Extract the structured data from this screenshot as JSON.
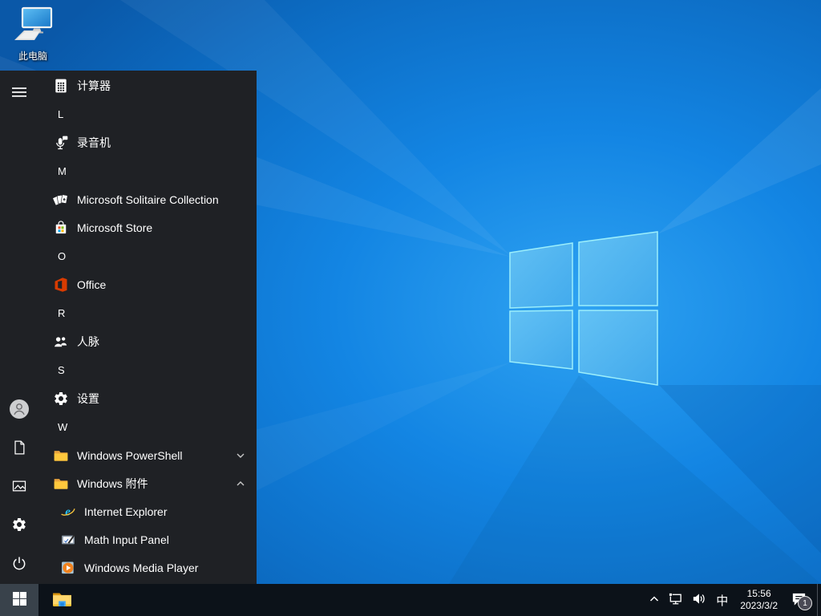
{
  "colors": {
    "wallpaper_blue": "#1385e3",
    "menu_bg": "#1f2125",
    "taskbar_bg": "#0c1219",
    "start_pressed": "#39424b",
    "folder_yellow": "#ffc83d",
    "office_orange": "#d83b01",
    "store_red": "#f25022",
    "store_green": "#7fba00",
    "store_blue": "#00a4ef",
    "store_yellow": "#ffb900",
    "ie_blue": "#26c2f3",
    "wmp_orange": "#f0821e"
  },
  "desktop": {
    "this_pc_label": "此电脑"
  },
  "start_menu": {
    "rail": [
      {
        "name": "menu",
        "icon": "hamburger"
      },
      {
        "name": "user",
        "icon": "user"
      },
      {
        "name": "documents",
        "icon": "document"
      },
      {
        "name": "pictures",
        "icon": "pictures"
      },
      {
        "name": "settings",
        "icon": "gear"
      },
      {
        "name": "power",
        "icon": "power"
      }
    ],
    "apps": [
      {
        "kind": "app",
        "label": "计算器",
        "icon": "calculator"
      },
      {
        "kind": "section",
        "label": "L"
      },
      {
        "kind": "app",
        "label": "录音机",
        "icon": "voice-recorder"
      },
      {
        "kind": "section",
        "label": "M"
      },
      {
        "kind": "app",
        "label": "Microsoft Solitaire Collection",
        "icon": "solitaire"
      },
      {
        "kind": "app",
        "label": "Microsoft Store",
        "icon": "store"
      },
      {
        "kind": "section",
        "label": "O"
      },
      {
        "kind": "app",
        "label": "Office",
        "icon": "office"
      },
      {
        "kind": "section",
        "label": "R"
      },
      {
        "kind": "app",
        "label": "人脉",
        "icon": "people"
      },
      {
        "kind": "section",
        "label": "S"
      },
      {
        "kind": "app",
        "label": "设置",
        "icon": "gear"
      },
      {
        "kind": "section",
        "label": "W"
      },
      {
        "kind": "folder",
        "label": "Windows PowerShell",
        "icon": "folder",
        "chevron": "down"
      },
      {
        "kind": "folder",
        "label": "Windows 附件",
        "icon": "folder",
        "chevron": "up"
      },
      {
        "kind": "subapp",
        "label": "Internet Explorer",
        "icon": "internet-explorer"
      },
      {
        "kind": "subapp",
        "label": "Math Input Panel",
        "icon": "math-input"
      },
      {
        "kind": "subapp",
        "label": "Windows Media Player",
        "icon": "media-player"
      }
    ]
  },
  "taskbar": {
    "start_icon": "windows",
    "pinned": [
      {
        "name": "file-explorer",
        "icon": "file-explorer"
      }
    ],
    "tray": {
      "ime_label": "中",
      "time": "15:56",
      "date": "2023/3/2",
      "notification_badge": "1"
    }
  }
}
